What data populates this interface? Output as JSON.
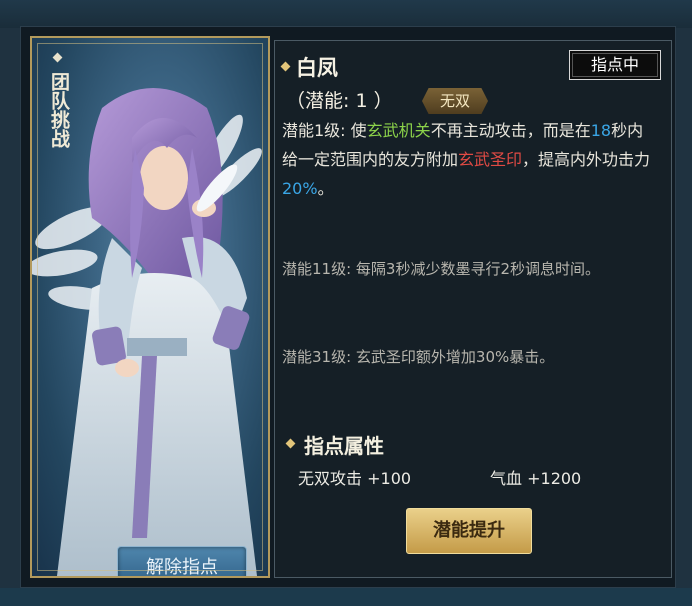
{
  "hero": {
    "mode_title": "团队挑战",
    "name": "白凤",
    "potential_label": "（潜能: 1 ）",
    "grade_badge": "无双",
    "state_button": "指点中",
    "release_button": "解除指点"
  },
  "skills": {
    "lv1": {
      "prefix": "潜能1级: 使",
      "hl1": "玄武机关",
      "mid1": "不再主动攻击，而是在",
      "hl2": "18",
      "mid2": "秒内给一定范围内的友方附加",
      "hl3": "玄武圣印",
      "mid3": "，提高内外功击力",
      "hl4": "20%",
      "suffix": "。"
    },
    "lv11": "潜能11级: 每隔3秒减少数墨寻行2秒调息时间。",
    "lv31": "潜能31级: 玄武圣印额外增加30%暴击。"
  },
  "attributes": {
    "title": "指点属性",
    "items": [
      {
        "label": "无双攻击",
        "value": "+100"
      },
      {
        "label": "气血",
        "value": "+1200"
      }
    ]
  },
  "upgrade_button": "潜能提升",
  "colors": {
    "green_highlight": "#8cd34a",
    "blue_highlight": "#3aa6e6",
    "red_highlight": "#e04a44",
    "gold_accent": "#e2c57a"
  }
}
